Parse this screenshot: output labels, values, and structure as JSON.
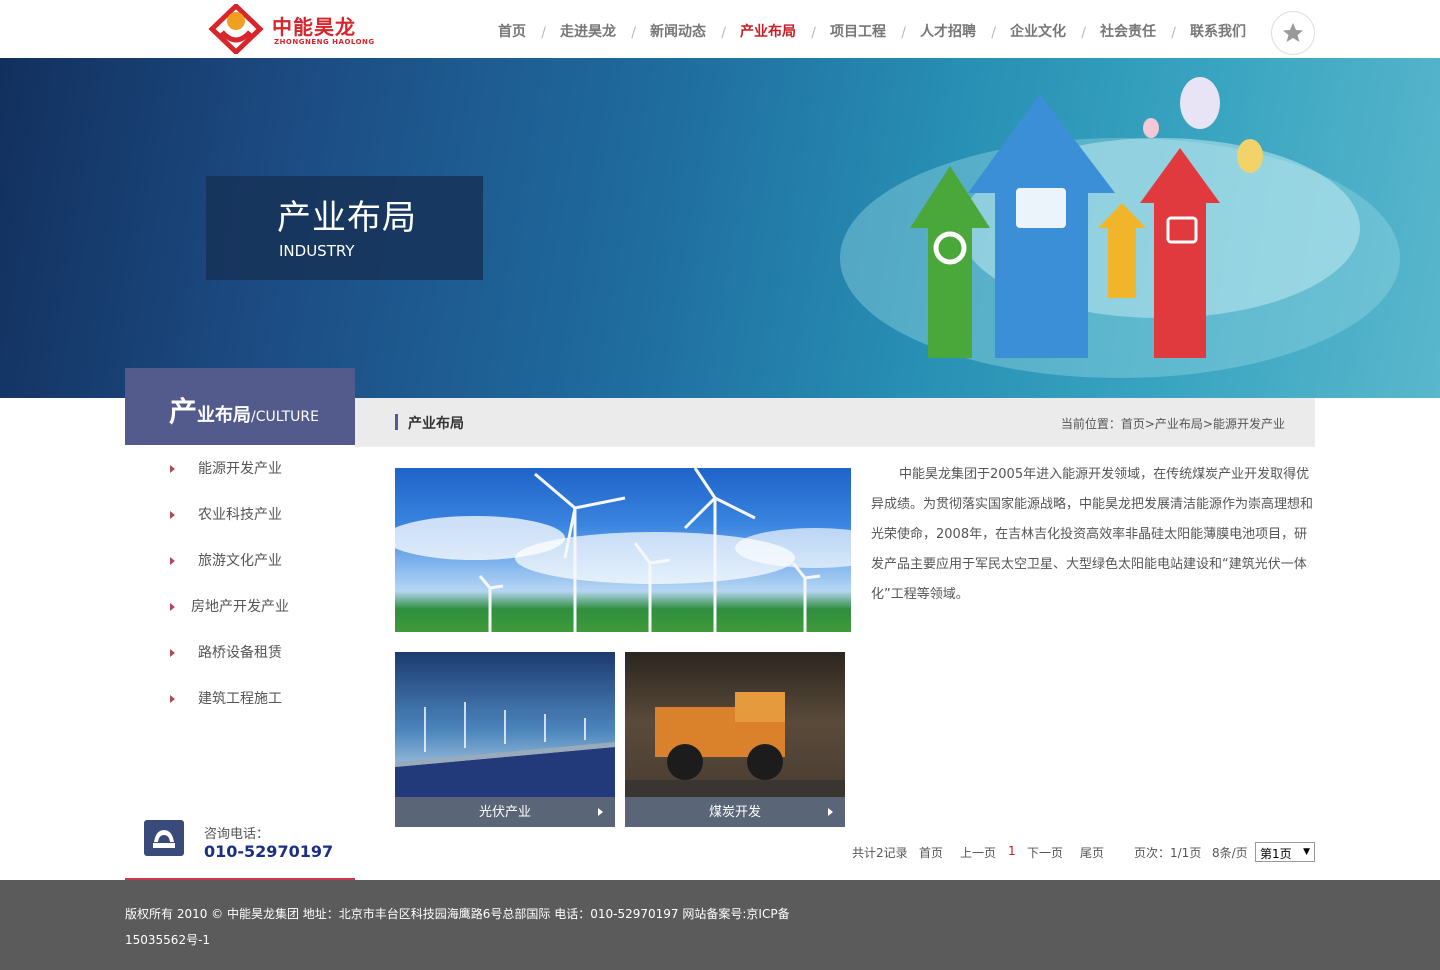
{
  "header": {
    "logo_cn": "中能昊龙",
    "logo_en": "ZHONGNENG HAOLONG",
    "nav": [
      {
        "label": "首页",
        "active": false
      },
      {
        "label": "走进昊龙",
        "active": false
      },
      {
        "label": "新闻动态",
        "active": false
      },
      {
        "label": "产业布局",
        "active": true
      },
      {
        "label": "项目工程",
        "active": false
      },
      {
        "label": "人才招聘",
        "active": false
      },
      {
        "label": "企业文化",
        "active": false
      },
      {
        "label": "社会责任",
        "active": false
      },
      {
        "label": "联系我们",
        "active": false
      }
    ],
    "favorite_icon": "star-icon"
  },
  "banner": {
    "title": "产业布局",
    "subtitle": "INDUSTRY"
  },
  "sidebar": {
    "heading_big": "产",
    "heading_rest": "业布局",
    "heading_en": "/CULTURE",
    "items": [
      {
        "label": "能源开发产业"
      },
      {
        "label": "农业科技产业"
      },
      {
        "label": "旅游文化产业"
      },
      {
        "label": "房地产开发产业"
      },
      {
        "label": "路桥设备租赁"
      },
      {
        "label": "建筑工程施工"
      }
    ],
    "contact_label": "咨询电话：",
    "contact_number": "010-52970197"
  },
  "content": {
    "section_title": "产业布局",
    "breadcrumb": "当前位置：首页>产业布局>能源开发产业",
    "description": "中能昊龙集团于2005年进入能源开发领域，在传统煤炭产业开发取得优异成绩。为贯彻落实国家能源战略，中能昊龙把发展清洁能源作为崇高理想和光荣使命，2008年，在吉林吉化投资高效率非晶硅太阳能薄膜电池项目，研发产品主要应用于军民太空卫星、大型绿色太阳能电站建设和“建筑光伏一体化”工程等领域。",
    "thumbs": [
      {
        "caption": "光伏产业"
      },
      {
        "caption": "煤炭开发"
      }
    ],
    "pager": {
      "total": "共计2记录",
      "first": "首页",
      "prev": "上一页",
      "current": "1",
      "next": "下一页",
      "last": "尾页",
      "page_info": "页次：1/1页",
      "per_page": "8条/页",
      "select_value": "第1页"
    }
  },
  "footer": {
    "line1": "版权所有 2010 © 中能昊龙集团 地址：北京市丰台区科技园海鹰路6号总部国际 电话：010-52970197    网站备案号:京ICP备",
    "line2": "15035562号-1"
  },
  "colors": {
    "brand_red": "#d8242b",
    "sidebar_head": "#535b8d",
    "footer_bg": "#5b5b5b"
  }
}
